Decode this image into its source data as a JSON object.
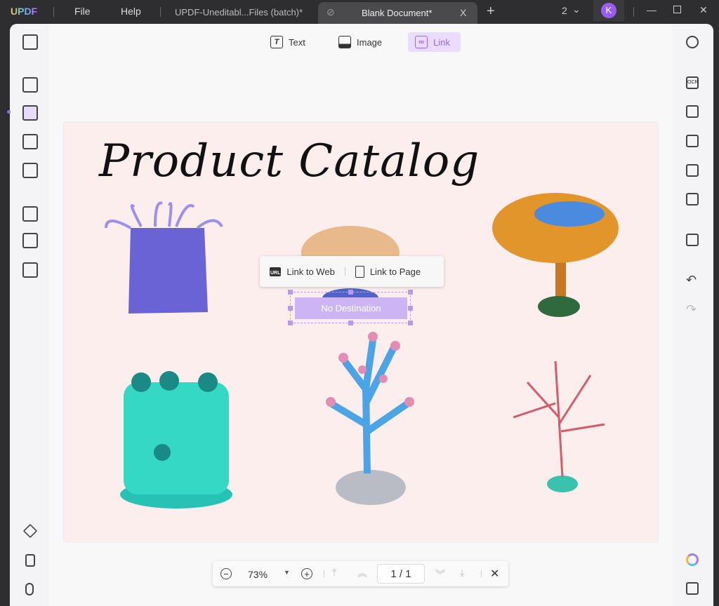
{
  "titlebar": {
    "logo": "UPDF",
    "menu": [
      "File",
      "Help"
    ],
    "tabs": [
      {
        "label": "UPDF-Uneditabl...Files (batch)*"
      },
      {
        "label": "Blank Document*",
        "close": "X"
      }
    ],
    "new_tab": "+",
    "window_count": "2",
    "avatar": "K"
  },
  "toolbar": {
    "text": "Text",
    "image": "Image",
    "link": "Link"
  },
  "document": {
    "title": "Product Catalog"
  },
  "link_popup": {
    "web": "Link to Web",
    "page": "Link to Page",
    "url_badge": "URL"
  },
  "link_box": {
    "label": "No Destination"
  },
  "zoombar": {
    "zoom": "73%",
    "page": "1 / 1"
  },
  "colors": {
    "accent": "#b46ef7",
    "page_bg": "#fdeeee"
  }
}
